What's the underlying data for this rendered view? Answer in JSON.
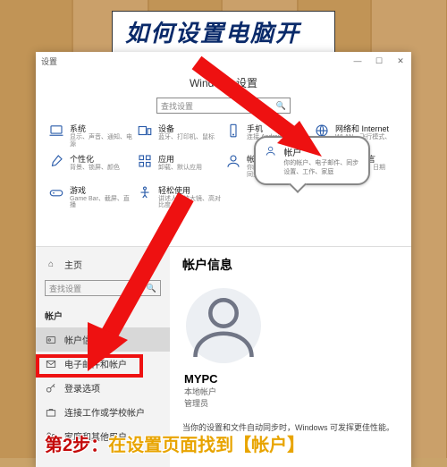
{
  "tutorial": {
    "title": "如何设置电脑开机密码",
    "step_prefix": "第2步：",
    "step_rest": "在设置页面找到【帐户】"
  },
  "window": {
    "app_label": "设置",
    "title": "Windows 设置",
    "search_placeholder": "查找设置",
    "min": "—",
    "max": "☐",
    "close": "✕"
  },
  "tiles": [
    {
      "icon": "laptop-icon",
      "h": "系统",
      "s": "显示、声音、通知、电源"
    },
    {
      "icon": "devices-icon",
      "h": "设备",
      "s": "蓝牙、打印机、鼠标"
    },
    {
      "icon": "phone-icon",
      "h": "手机",
      "s": "连接 Android、iPhone"
    },
    {
      "icon": "globe-icon",
      "h": "网络和 Internet",
      "s": "WLAN、飞行模式、VPN"
    },
    {
      "icon": "brush-icon",
      "h": "个性化",
      "s": "背景、锁屏、颜色"
    },
    {
      "icon": "apps-icon",
      "h": "应用",
      "s": "卸载、默认应用"
    },
    {
      "icon": "user-icon",
      "h": "帐户",
      "s": "你的帐户、电子邮件、同步设置、工作、家庭"
    },
    {
      "icon": "clock-icon",
      "h": "时间和语言",
      "s": "语音、区域、日期"
    },
    {
      "icon": "game-icon",
      "h": "游戏",
      "s": "Game Bar、截屏、直播"
    },
    {
      "icon": "ease-icon",
      "h": "轻松使用",
      "s": "讲述人、放大镜、高对比度"
    }
  ],
  "bubble": {
    "h": "帐户",
    "s": "你的帐户、电子邮件、同步设置、工作、家庭"
  },
  "sidebar": {
    "home": "主页",
    "search_placeholder": "查找设置",
    "section": "帐户",
    "items": [
      {
        "icon": "id-icon",
        "label": "帐户信息"
      },
      {
        "icon": "mail-icon",
        "label": "电子邮件和帐户"
      },
      {
        "icon": "key-icon",
        "label": "登录选项"
      },
      {
        "icon": "briefcase-icon",
        "label": "连接工作或学校帐户"
      },
      {
        "icon": "family-icon",
        "label": "家庭和其他用户"
      }
    ]
  },
  "account": {
    "heading": "帐户信息",
    "name": "MYPC",
    "type": "本地帐户",
    "role": "管理员",
    "desc": "当你的设置和文件自动同步时，Windows 可发挥更佳性能。"
  }
}
